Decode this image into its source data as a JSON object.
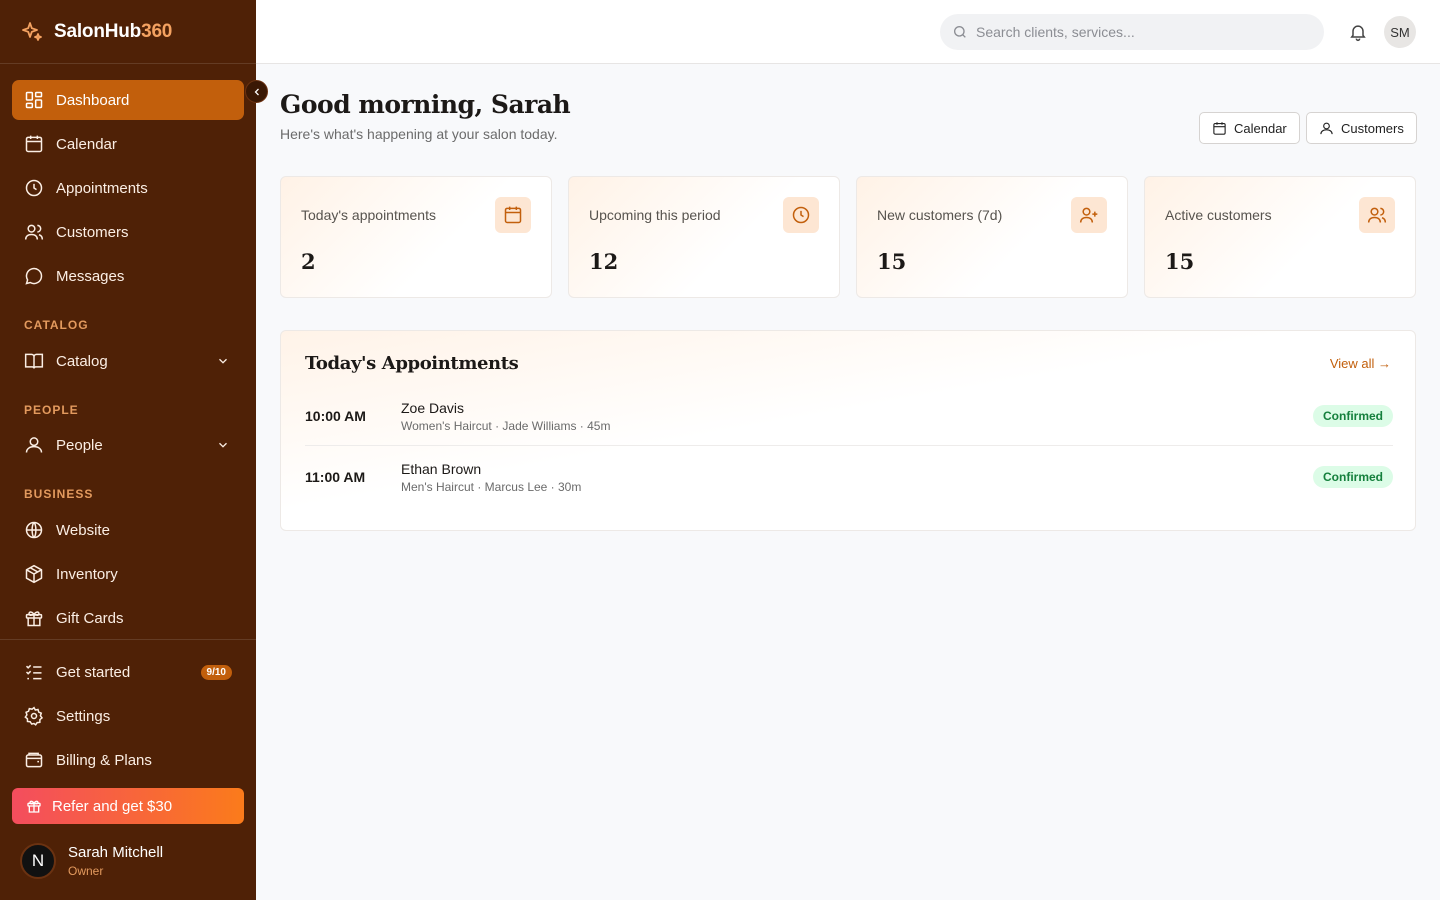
{
  "brand": {
    "name": "SalonHub",
    "accent": "360"
  },
  "sidebar": {
    "main": [
      {
        "label": "Dashboard",
        "icon": "dashboard-icon"
      },
      {
        "label": "Calendar",
        "icon": "calendar-icon"
      },
      {
        "label": "Appointments",
        "icon": "clock-icon"
      },
      {
        "label": "Customers",
        "icon": "users-icon"
      },
      {
        "label": "Messages",
        "icon": "message-icon"
      }
    ],
    "sections": {
      "catalog": {
        "label": "CATALOG",
        "item": "Catalog"
      },
      "people": {
        "label": "PEOPLE",
        "item": "People"
      },
      "business": {
        "label": "BUSINESS",
        "items": [
          "Website",
          "Inventory",
          "Gift Cards"
        ]
      }
    },
    "bottom": {
      "get_started": "Get started",
      "get_started_badge": "9/10",
      "settings": "Settings",
      "billing": "Billing & Plans",
      "refer": "Refer and get $30"
    },
    "user": {
      "initial": "N",
      "name": "Sarah Mitchell",
      "role": "Owner"
    }
  },
  "header": {
    "search_placeholder": "Search clients, services...",
    "avatar_initials": "SM"
  },
  "main": {
    "greeting": "Good morning, Sarah",
    "subtitle": "Here's what's happening at your salon today.",
    "buttons": {
      "calendar": "Calendar",
      "customers": "Customers"
    },
    "stats": [
      {
        "title": "Today's appointments",
        "value": "2",
        "icon": "calendar-icon"
      },
      {
        "title": "Upcoming this period",
        "value": "12",
        "icon": "clock-icon"
      },
      {
        "title": "New customers (7d)",
        "value": "15",
        "icon": "user-plus-icon"
      },
      {
        "title": "Active customers",
        "value": "15",
        "icon": "users-icon"
      }
    ],
    "appointments": {
      "title": "Today's Appointments",
      "view_all": "View all →",
      "rows": [
        {
          "time": "10:00 AM",
          "name": "Zoe Davis",
          "meta": "Women's Haircut · Jade Williams · 45m",
          "status": "Confirmed"
        },
        {
          "time": "11:00 AM",
          "name": "Ethan Brown",
          "meta": "Men's Haircut · Marcus Lee · 30m",
          "status": "Confirmed"
        }
      ]
    }
  },
  "colors": {
    "sidebar_bg": "#4f2106",
    "accent": "#c25f0c",
    "status_confirmed": "#15803d"
  }
}
